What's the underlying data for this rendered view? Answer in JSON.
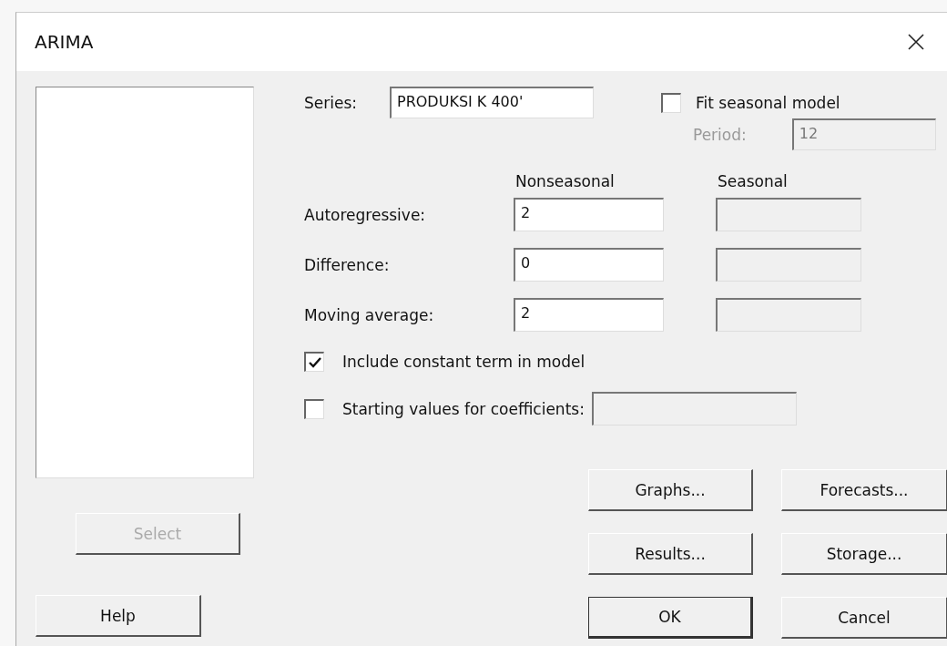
{
  "window": {
    "title": "ARIMA"
  },
  "select_button": {
    "label": "Select",
    "disabled": true
  },
  "help_button": {
    "label": "Help"
  },
  "series": {
    "label": "Series:",
    "value": "PRODUKSI K 400'"
  },
  "fit_seasonal": {
    "label": "Fit seasonal model",
    "checked": false
  },
  "period": {
    "label": "Period:",
    "value": "12",
    "disabled": true
  },
  "orders": {
    "headers": [
      "Nonseasonal",
      "Seasonal"
    ],
    "seasonal_disabled": true,
    "rows": [
      {
        "label": "Autoregressive:",
        "nonseasonal": "2"
      },
      {
        "label": "Difference:",
        "nonseasonal": "0"
      },
      {
        "label": "Moving average:",
        "nonseasonal": "2"
      }
    ]
  },
  "options": [
    {
      "kind": "checkbox",
      "label": "Include constant term in model",
      "checked": true
    },
    {
      "kind": "checkbox_field",
      "label": "Starting values for coefficients:",
      "checked": false,
      "field_disabled": true
    }
  ],
  "buttons": [
    {
      "label": "Graphs...",
      "default": false
    },
    {
      "label": "Forecasts...",
      "default": false
    },
    {
      "label": "Results...",
      "default": false
    },
    {
      "label": "Storage...",
      "default": false
    },
    {
      "label": "OK",
      "default": true
    },
    {
      "label": "Cancel",
      "default": false
    }
  ]
}
